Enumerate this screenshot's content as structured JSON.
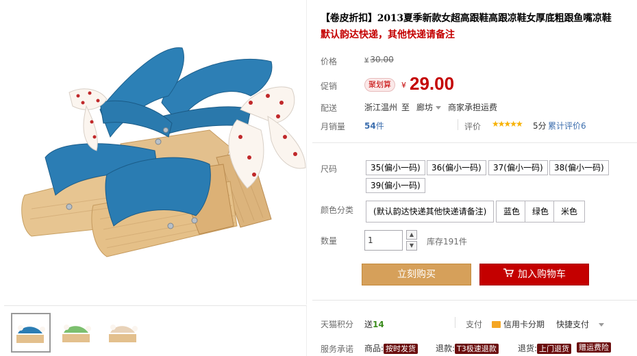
{
  "product": {
    "title": "【卷皮折扣】2013夏季新款女超高跟鞋高跟凉鞋女厚底粗跟鱼嘴凉鞋",
    "subtitle": "默认韵达快递，其他快递请备注"
  },
  "price": {
    "label": "价格",
    "currency": "¥",
    "original": "30.00"
  },
  "promo": {
    "label": "促销",
    "badge": "聚划算",
    "currency": "¥",
    "value": "29.00"
  },
  "shipping": {
    "label": "配送",
    "from": "浙江温州",
    "to_word": "至",
    "to": "廊坊",
    "fee": "商家承担运费"
  },
  "sales": {
    "label": "月销量",
    "count": "54",
    "unit": "件",
    "rating_label": "评价",
    "stars": "★★★★★",
    "score": "5分",
    "review_link": "累计评价6"
  },
  "size": {
    "label": "尺码",
    "options": [
      "35(偏小一码)",
      "36(偏小一码)",
      "37(偏小一码)",
      "38(偏小一码)",
      "39(偏小一码)"
    ]
  },
  "color": {
    "label": "颜色分类",
    "options": [
      "(默认韵达快递其他快递请备注)",
      "蓝色",
      "绿色",
      "米色"
    ]
  },
  "quantity": {
    "label": "数量",
    "value": "1",
    "stock": "库存191件"
  },
  "actions": {
    "buy_now": "立刻购买",
    "add_to_cart": "加入购物车"
  },
  "points": {
    "label": "天猫积分",
    "prefix": "送",
    "value": "14",
    "pay_label": "支付",
    "credit": "信用卡分期",
    "quick_pay": "快捷支付"
  },
  "service": {
    "label": "服务承诺",
    "goods_label": "商品:",
    "goods_tag": "按时发货",
    "refund_label": "退款:",
    "refund_tag": "T3极速退款",
    "return_label": "退货:",
    "return_tag": "上门退货",
    "extra_tag": "赠运费险"
  },
  "colors": {
    "accent_red": "#c40000",
    "buy_orange": "#d6a05a",
    "link_blue": "#3c6eae"
  }
}
